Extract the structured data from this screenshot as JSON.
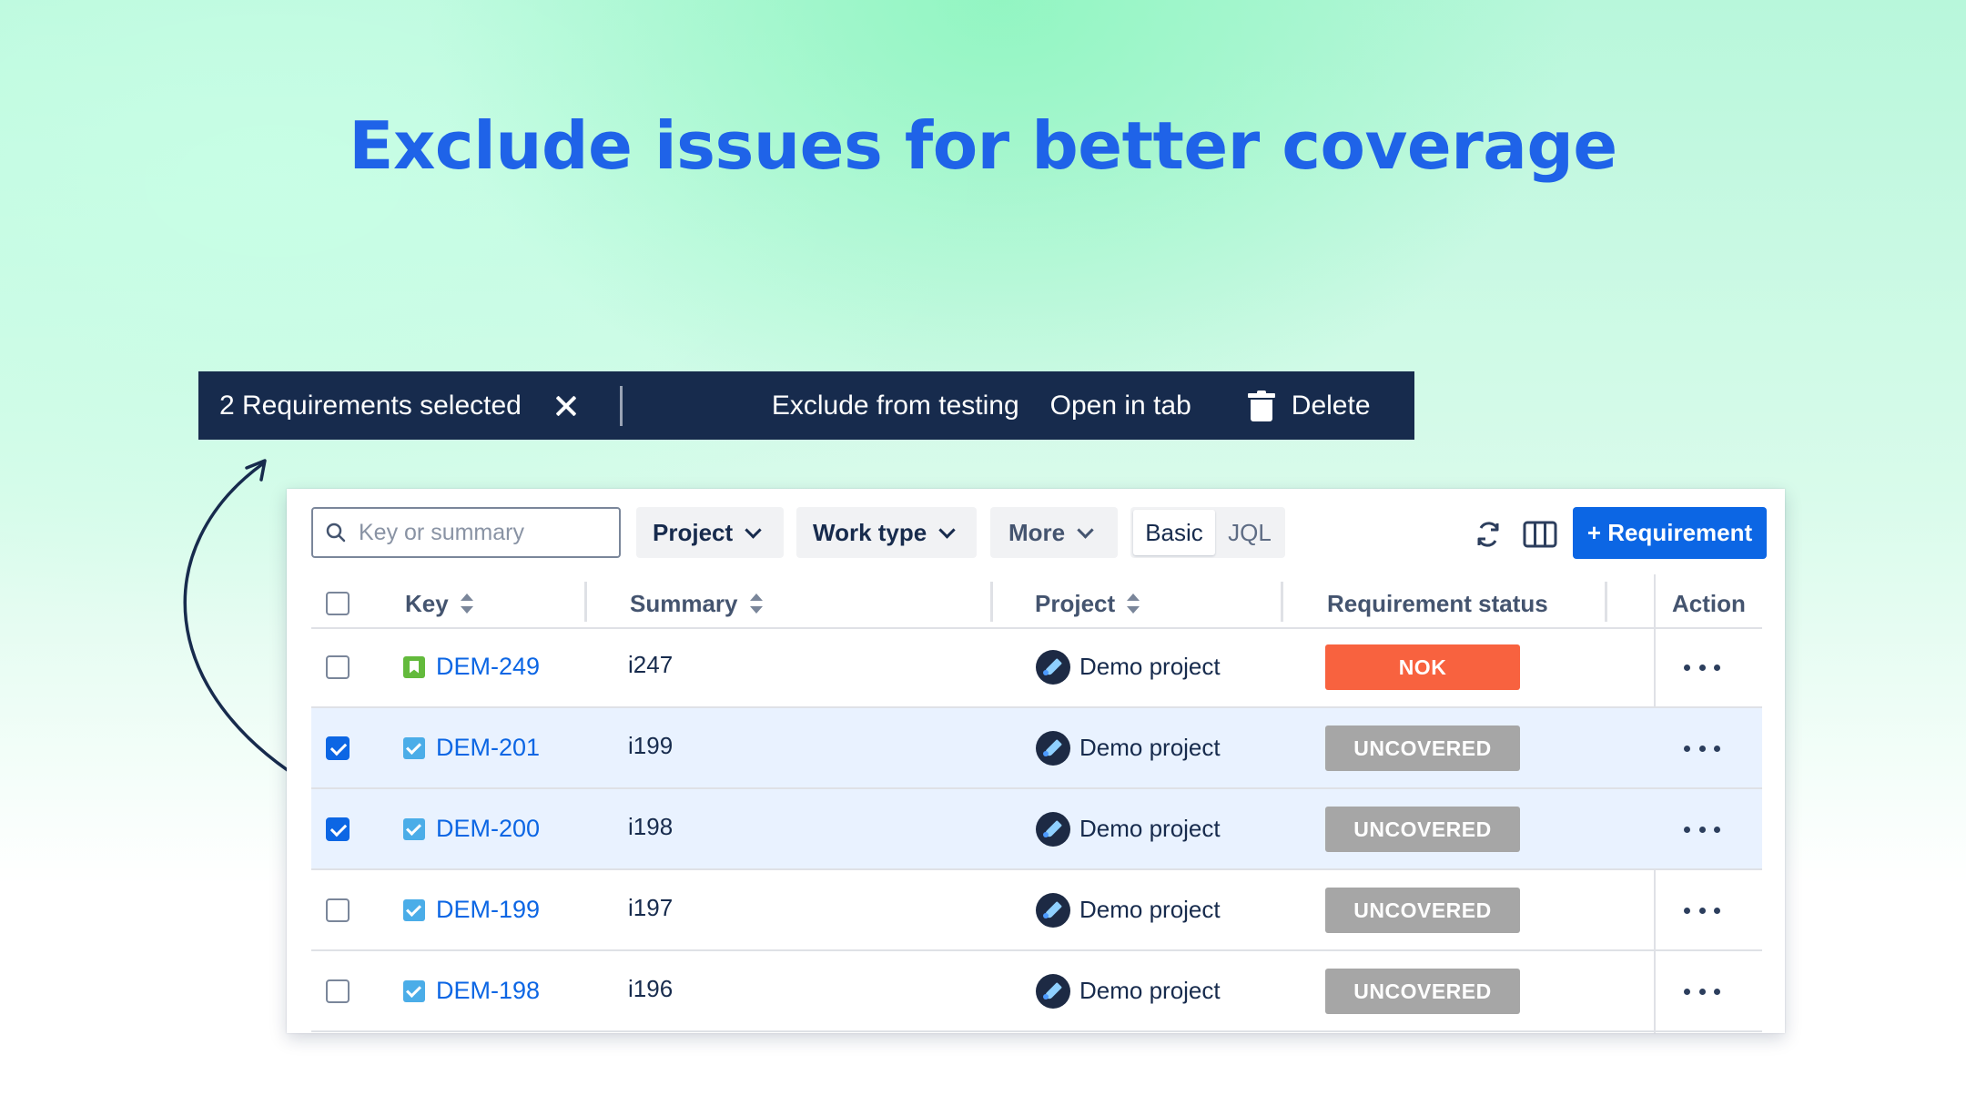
{
  "headline": "Exclude issues for better coverage",
  "selection_bar": {
    "count_text": "2 Requirements selected",
    "actions": [
      "Exclude from testing",
      "Open in tab",
      "Delete"
    ]
  },
  "toolbar": {
    "search_placeholder": "Key or summary",
    "filters": [
      "Project",
      "Work type",
      "More"
    ],
    "view_toggle": [
      "Basic",
      "JQL"
    ],
    "selected_view": "Basic",
    "create_button": "+ Requirement"
  },
  "table": {
    "headers": {
      "key": "Key",
      "summary": "Summary",
      "project": "Project",
      "status": "Requirement status",
      "action": "Action"
    },
    "rows": [
      {
        "key": "DEM-249",
        "summary": "i247",
        "project": "Demo project",
        "status": "NOK",
        "checked": false
      },
      {
        "key": "DEM-201",
        "summary": "i199",
        "project": "Demo project",
        "status": "UNCOVERED",
        "checked": true
      },
      {
        "key": "DEM-200",
        "summary": "i198",
        "project": "Demo project",
        "status": "UNCOVERED",
        "checked": true
      },
      {
        "key": "DEM-199",
        "summary": "i197",
        "project": "Demo project",
        "status": "UNCOVERED",
        "checked": false
      },
      {
        "key": "DEM-198",
        "summary": "i196",
        "project": "Demo project",
        "status": "UNCOVERED",
        "checked": false
      }
    ]
  },
  "colors": {
    "headline": "#1f63e8",
    "selection_bar_bg": "#172b4d",
    "status_nok": "#f8623f",
    "status_uncovered": "#a6a6a6",
    "selected_row_bg": "#e9f2ff",
    "primary": "#0c66e4"
  },
  "icons": {
    "search": "search-icon",
    "close": "close-icon",
    "delete": "trash-icon",
    "refresh": "refresh-icon",
    "columns": "columns-icon",
    "chevron": "chevron-down-icon",
    "sort": "sort-icon",
    "more": "more-actions-icon"
  }
}
